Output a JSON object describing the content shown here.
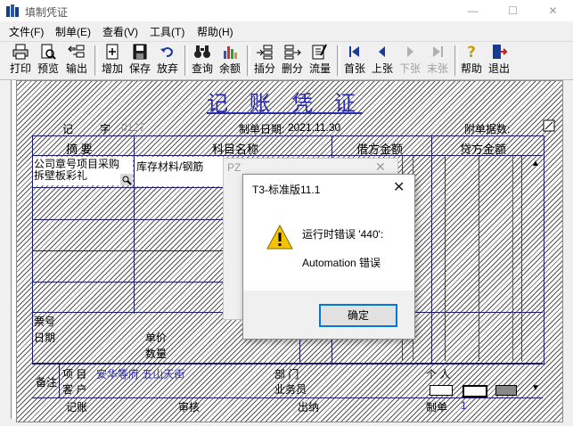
{
  "window": {
    "title": "填制凭证",
    "minimize": "—",
    "maximize": "☐",
    "close": "✕"
  },
  "menu": [
    "文件(F)",
    "制单(E)",
    "查看(V)",
    "工具(T)",
    "帮助(H)"
  ],
  "toolbar": [
    {
      "label": "打印",
      "icon": "printer-icon",
      "enabled": true
    },
    {
      "label": "预览",
      "icon": "preview-icon",
      "enabled": true
    },
    {
      "label": "输出",
      "icon": "export-icon",
      "enabled": true
    },
    {
      "label": "增加",
      "icon": "add-icon",
      "enabled": true
    },
    {
      "label": "保存",
      "icon": "save-icon",
      "enabled": true
    },
    {
      "label": "放弃",
      "icon": "undo-icon",
      "enabled": true
    },
    {
      "label": "查询",
      "icon": "binoculars-icon",
      "enabled": true
    },
    {
      "label": "余额",
      "icon": "balance-chart-icon",
      "enabled": true
    },
    {
      "label": "插分",
      "icon": "insert-row-icon",
      "enabled": true
    },
    {
      "label": "删分",
      "icon": "delete-row-icon",
      "enabled": true
    },
    {
      "label": "流量",
      "icon": "cashflow-icon",
      "enabled": true
    },
    {
      "label": "首张",
      "icon": "first-icon",
      "enabled": true
    },
    {
      "label": "上张",
      "icon": "prev-icon",
      "enabled": true
    },
    {
      "label": "下张",
      "icon": "next-icon",
      "enabled": false
    },
    {
      "label": "末张",
      "icon": "last-icon",
      "enabled": false
    },
    {
      "label": "帮助",
      "icon": "help-icon",
      "enabled": true
    },
    {
      "label": "退出",
      "icon": "exit-icon",
      "enabled": true
    }
  ],
  "voucher": {
    "title": "记 账 凭 证",
    "type_label": "记",
    "number_label": "字",
    "number": "0127",
    "date_label": "制单日期:",
    "date": "2021.11.30",
    "attachments_label": "附单据数:",
    "headers": {
      "summary": "摘 要",
      "account": "科目名称",
      "debit": "借方金额",
      "credit": "贷方金额"
    },
    "row1": {
      "summary": "公司章号项目采购拆壁板彩礼",
      "account": "库存材料/钢筋"
    },
    "bill_no_label": "票号",
    "date2_label": "日期",
    "unit_price_label": "单价",
    "quantity_label": "数量",
    "note_label": "备注",
    "project_label": "项 目",
    "project_value": "安华等府  五山天街",
    "dept_label": "部 门",
    "person_label": "个 人",
    "customer_label": "客 户",
    "salesperson_label": "业务员",
    "bookkeeper_label": "记账",
    "auditor_label": "审核",
    "cashier_label": "出纳",
    "maker_label": "制单",
    "maker_value": "1"
  },
  "pz_window": {
    "title": "PZ"
  },
  "dialog": {
    "title": "T3-标准版11.1",
    "message1": "运行时错误 '440':",
    "message2": "Automation 错误",
    "ok": "确定"
  }
}
